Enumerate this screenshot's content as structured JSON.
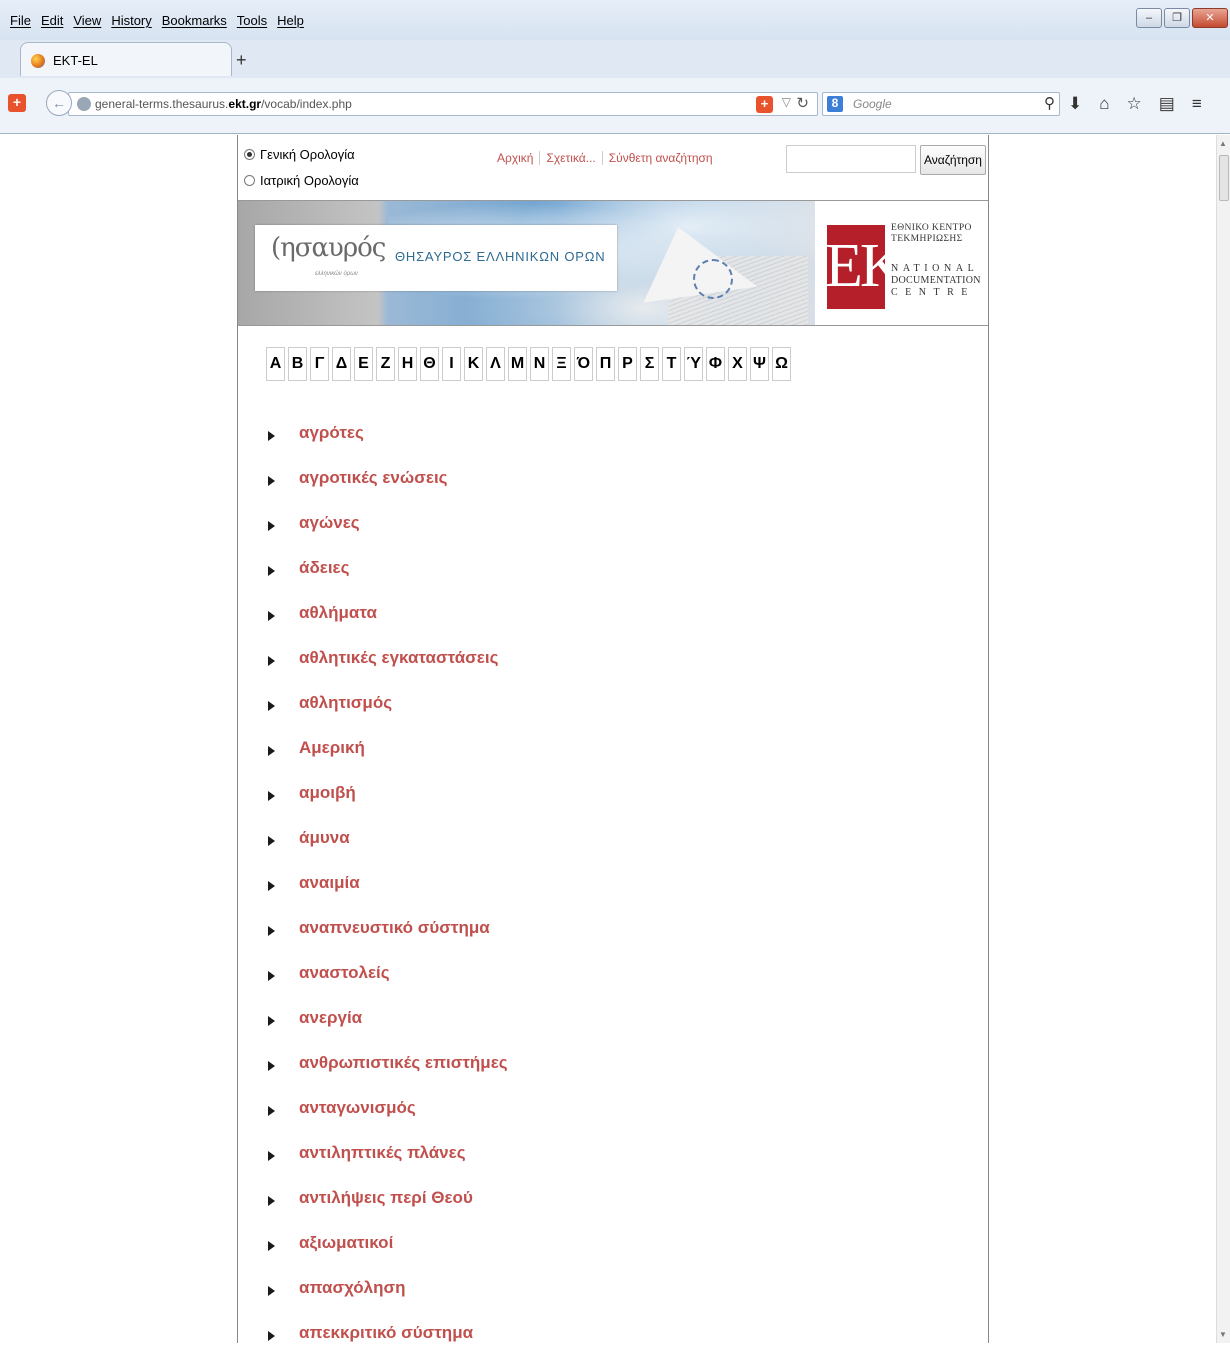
{
  "browser": {
    "menu": [
      "File",
      "Edit",
      "View",
      "History",
      "Bookmarks",
      "Tools",
      "Help"
    ],
    "tab_title": "EKT-EL",
    "url_prefix": "general-terms.thesaurus.",
    "url_domain": "ekt.gr",
    "url_path": "/vocab/index.php",
    "search_placeholder": "Google"
  },
  "page": {
    "radio_general": "Γενική Ορολογία",
    "radio_medical": "Ιατρική Ορολογία",
    "links": [
      "Αρχική",
      "Σχετικά...",
      "Σύνθετη αναζήτηση"
    ],
    "search_button": "Αναζήτηση",
    "banner": {
      "logo_text": "ησαυρός",
      "logo_sub": "ελληνικών όρων",
      "title": "ΘΗΣΑΥΡΟΣ ΕΛΛΗΝΙΚΩΝ ΟΡΩΝ",
      "ekt_logo": "EKT",
      "ekt_line1": "ΕΘΝΙΚΟ ΚΕΝΤΡΟ",
      "ekt_line2": "ΤΕΚΜΗΡΙΩΣΗΣ",
      "ekt_line3": "NATIONAL",
      "ekt_line4": "DOCUMENTATION",
      "ekt_line5": "CENTRE"
    },
    "alphabet": [
      "Α",
      "Β",
      "Γ",
      "Δ",
      "Ε",
      "Ζ",
      "Η",
      "Θ",
      "Ι",
      "Κ",
      "Λ",
      "Μ",
      "Ν",
      "Ξ",
      "Ό",
      "Π",
      "Ρ",
      "Σ",
      "Τ",
      "Ύ",
      "Φ",
      "Χ",
      "Ψ",
      "Ω"
    ],
    "terms": [
      "αγρότες",
      "αγροτικές ενώσεις",
      "αγώνες",
      "άδειες",
      "αθλήματα",
      "αθλητικές εγκαταστάσεις",
      "αθλητισμός",
      "Αμερική",
      "αμοιβή",
      "άμυνα",
      "αναιμία",
      "αναπνευστικό σύστημα",
      "αναστολείς",
      "ανεργία",
      "ανθρωπιστικές επιστήμες",
      "ανταγωνισμός",
      "αντιληπτικές πλάνες",
      "αντιλήψεις περί Θεού",
      "αξιωματικοί",
      "απασχόληση",
      "απεκκριτικό σύστημα"
    ]
  },
  "colors": {
    "link": "#c0504d",
    "ekt_red": "#b51f2a",
    "banner_title": "#2e6a92"
  }
}
